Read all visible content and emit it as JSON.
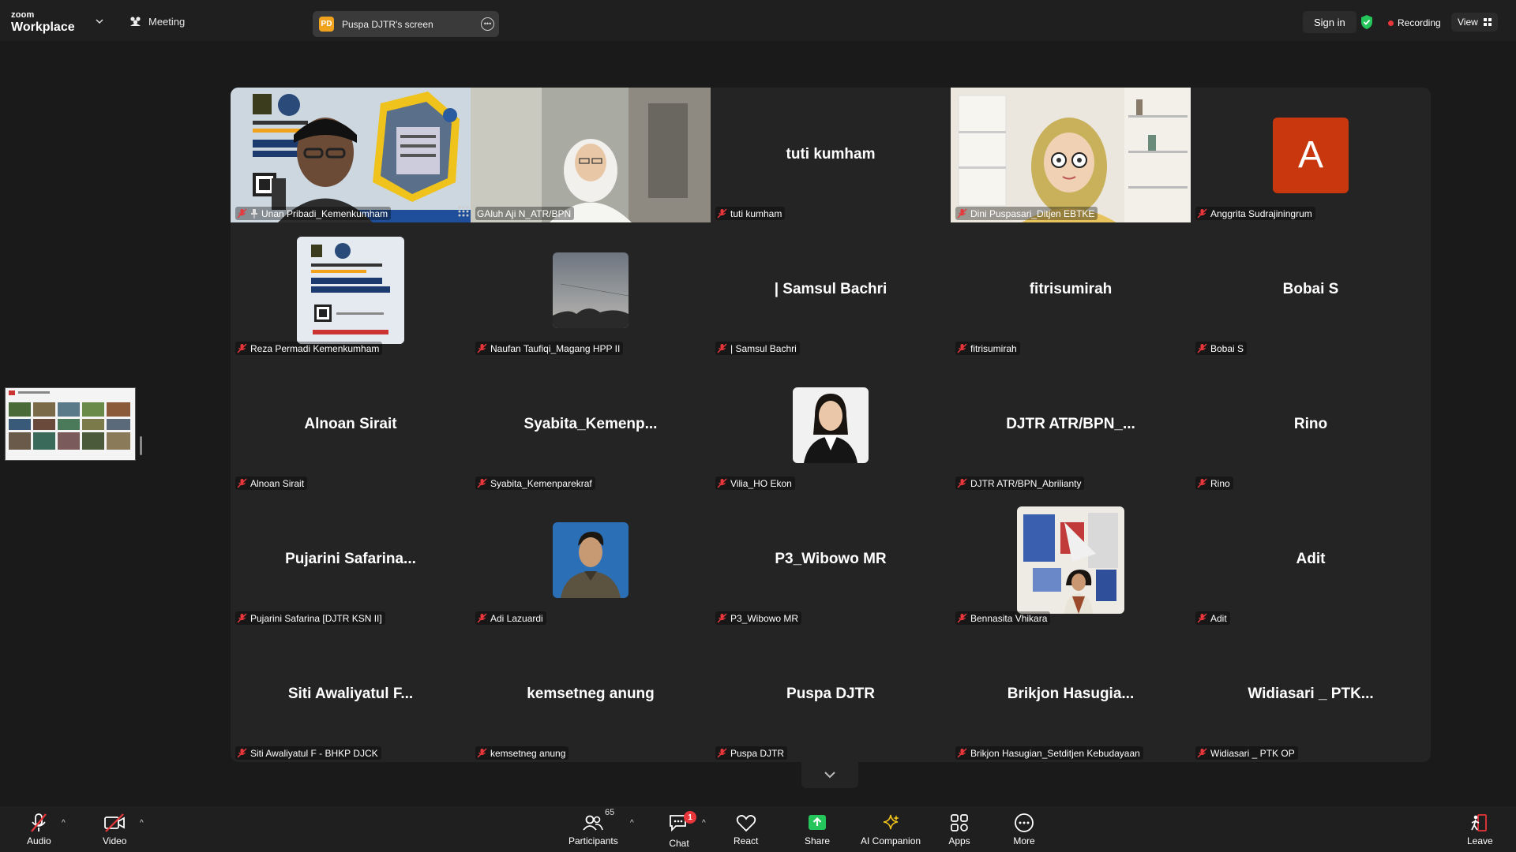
{
  "topbar": {
    "brand_small": "zoom",
    "brand_large": "Workplace",
    "meeting_label": "Meeting",
    "share_initials": "PD",
    "share_label": "Puspa DJTR's screen",
    "sign_in": "Sign in",
    "recording": "Recording",
    "view": "View"
  },
  "tiles": [
    {
      "name": "Unan Pribadi_Kemenkumham",
      "big": "",
      "kind": "video-slide",
      "pinned": true
    },
    {
      "name": "GAluh Aji N_ATR/BPN",
      "big": "",
      "kind": "video-person",
      "active": true
    },
    {
      "name": "tuti kumham",
      "big": "tuti kumham",
      "kind": "text"
    },
    {
      "name": "Dini Puspasari_Ditjen EBTKE",
      "big": "",
      "kind": "video-avatar"
    },
    {
      "name": "Anggrita Sudrajiningrum",
      "big": "A",
      "kind": "letter"
    },
    {
      "name": "Reza Permadi Kemenkumham",
      "big": "",
      "kind": "pic-slide"
    },
    {
      "name": "Naufan Taufiqi_Magang HPP II",
      "big": "",
      "kind": "pic-sky"
    },
    {
      "name": "| Samsul Bachri",
      "big": "| Samsul  Bachri",
      "kind": "text"
    },
    {
      "name": "fitrisumirah",
      "big": "fitrisumirah",
      "kind": "text"
    },
    {
      "name": "Bobai S",
      "big": "Bobai S",
      "kind": "text"
    },
    {
      "name": "Alnoan Sirait",
      "big": "Alnoan Sirait",
      "kind": "text"
    },
    {
      "name": "Syabita_Kemenparekraf",
      "big": "Syabita_Kemenp...",
      "kind": "text"
    },
    {
      "name": "Vilia_HO Ekon",
      "big": "",
      "kind": "pic-woman"
    },
    {
      "name": "DJTR ATR/BPN_Abrilianty",
      "big": "DJTR  ATR/BPN_...",
      "kind": "text"
    },
    {
      "name": "Rino",
      "big": "Rino",
      "kind": "text"
    },
    {
      "name": "Pujarini Safarina [DJTR KSN II]",
      "big": "Pujarini  Safarina...",
      "kind": "text"
    },
    {
      "name": "Adi Lazuardi",
      "big": "",
      "kind": "pic-man"
    },
    {
      "name": "P3_Wibowo MR",
      "big": "P3_Wibowo MR",
      "kind": "text"
    },
    {
      "name": "Bennasita Vhikara",
      "big": "",
      "kind": "pic-art"
    },
    {
      "name": "Adit",
      "big": "Adit",
      "kind": "text"
    },
    {
      "name": "Siti Awaliyatul F - BHKP DJCK",
      "big": "Siti  Awaliyatul  F...",
      "kind": "text"
    },
    {
      "name": "kemsetneg anung",
      "big": "kemsetneg anung",
      "kind": "text"
    },
    {
      "name": "Puspa DJTR",
      "big": "Puspa DJTR",
      "kind": "text"
    },
    {
      "name": "Brikjon Hasugian_Setditjen Kebudayaan",
      "big": "Brikjon  Hasugia...",
      "kind": "text"
    },
    {
      "name": "Widiasari _ PTK OP",
      "big": "Widiasari _ PTK...",
      "kind": "text"
    }
  ],
  "toolbar": {
    "audio": "Audio",
    "video": "Video",
    "participants": "Participants",
    "participants_count": "65",
    "chat": "Chat",
    "chat_badge": "1",
    "react": "React",
    "share": "Share",
    "ai_companion": "AI Companion",
    "apps": "Apps",
    "more": "More",
    "leave": "Leave"
  },
  "colors": {
    "active_speaker": "#23d160",
    "share_green": "#24c55a",
    "avatar_letter_bg": "#c9370f",
    "recording_dot": "#e8363b"
  }
}
